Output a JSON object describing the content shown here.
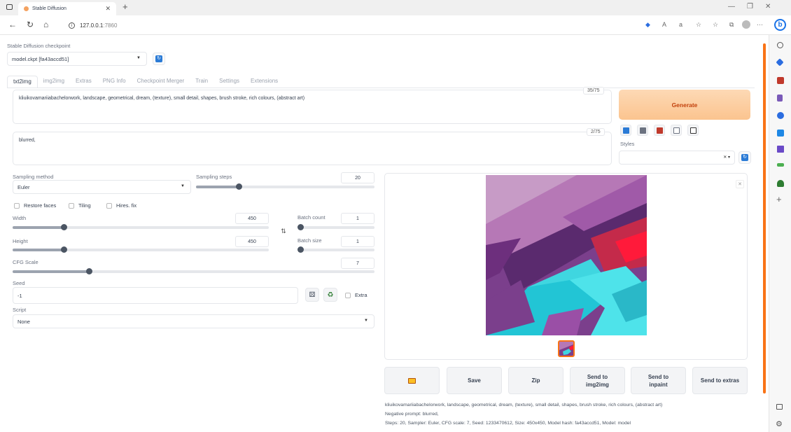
{
  "browser": {
    "tab_title": "Stable Diffusion",
    "url_host": "127.0.0.1",
    "url_port": ":7860"
  },
  "checkpoint": {
    "label": "Stable Diffusion checkpoint",
    "value": "model.ckpt [fa43accd51]"
  },
  "tabs": [
    "txt2img",
    "img2img",
    "Extras",
    "PNG Info",
    "Checkpoint Merger",
    "Train",
    "Settings",
    "Extensions"
  ],
  "prompt": {
    "text": "kliuikovamariiabachelorwork, landscape, geometrical, dream, (texture), small detail, shapes, brush stroke, rich colours, (abstract art)",
    "counter": "35/75"
  },
  "negative_prompt": {
    "text": "blurred,",
    "counter": "2/75"
  },
  "generate_label": "Generate",
  "styles_label": "Styles",
  "sampling": {
    "method_label": "Sampling method",
    "method_value": "Euler",
    "steps_label": "Sampling steps",
    "steps_value": "20",
    "steps_fraction": 0.24
  },
  "checkboxes": {
    "restore_faces": "Restore faces",
    "tiling": "Tiling",
    "hires_fix": "Hires. fix",
    "extra": "Extra"
  },
  "width": {
    "label": "Width",
    "value": "450",
    "fraction": 0.2
  },
  "height": {
    "label": "Height",
    "value": "450",
    "fraction": 0.2
  },
  "batch_count": {
    "label": "Batch count",
    "value": "1"
  },
  "batch_size": {
    "label": "Batch size",
    "value": "1"
  },
  "cfg": {
    "label": "CFG Scale",
    "value": "7",
    "fraction": 0.21
  },
  "seed": {
    "label": "Seed",
    "value": "-1"
  },
  "script": {
    "label": "Script",
    "value": "None"
  },
  "actions": {
    "save": "Save",
    "zip": "Zip",
    "send_img2img_1": "Send to",
    "send_img2img_2": "img2img",
    "send_inpaint_1": "Send to",
    "send_inpaint_2": "inpaint",
    "send_extras": "Send to extras"
  },
  "output_info": {
    "line1": "kliuikovamariiabachelorwork, landscape, geometrical, dream, (texture), small detail, shapes, brush stroke, rich colours, (abstract art)",
    "line2": "Negative prompt: blurred,",
    "line3": "Steps: 20, Sampler: Euler, CFG scale: 7, Seed: 1233470612, Size: 450x450, Model hash: fa43accd51, Model: model"
  },
  "colors": {
    "accent": "#f97316",
    "generate_bg": "#fbc48f",
    "icon_blue": "#2b7bd6"
  }
}
